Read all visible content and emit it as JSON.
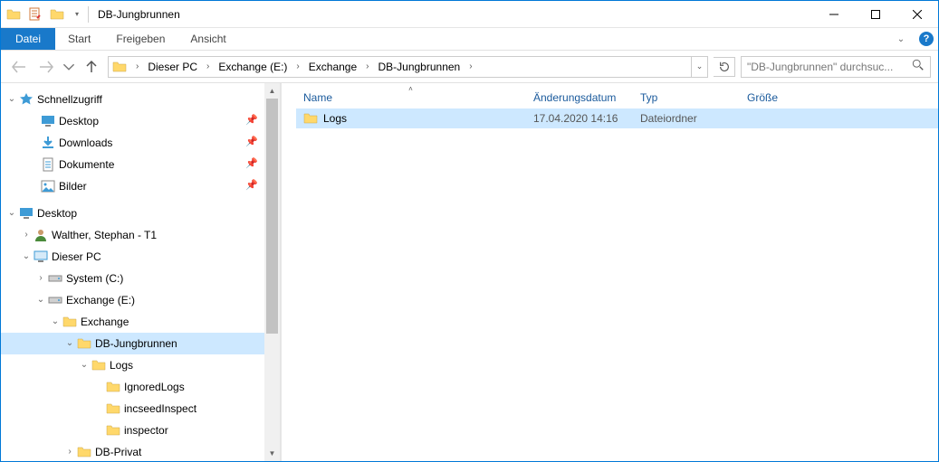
{
  "window": {
    "title": "DB-Jungbrunnen"
  },
  "ribbon": {
    "file": "Datei",
    "tabs": [
      "Start",
      "Freigeben",
      "Ansicht"
    ]
  },
  "breadcrumb": {
    "segments": [
      "Dieser PC",
      "Exchange (E:)",
      "Exchange",
      "DB-Jungbrunnen"
    ]
  },
  "search": {
    "placeholder": "\"DB-Jungbrunnen\" durchsuc..."
  },
  "columns": {
    "name": "Name",
    "modified": "Änderungsdatum",
    "type": "Typ",
    "size": "Größe"
  },
  "rows": [
    {
      "name": "Logs",
      "modified": "17.04.2020 14:16",
      "type": "Dateiordner",
      "size": ""
    }
  ],
  "tree": {
    "quickaccess": "Schnellzugriff",
    "qa_items": [
      "Desktop",
      "Downloads",
      "Dokumente",
      "Bilder"
    ],
    "desktop": "Desktop",
    "user": "Walther, Stephan - T1",
    "thispc": "Dieser PC",
    "drive_c": "System (C:)",
    "drive_e": "Exchange (E:)",
    "exchange": "Exchange",
    "dbj": "DB-Jungbrunnen",
    "logs": "Logs",
    "logs_children": [
      "IgnoredLogs",
      "incseedInspect",
      "inspector"
    ],
    "dbprivat": "DB-Privat"
  }
}
